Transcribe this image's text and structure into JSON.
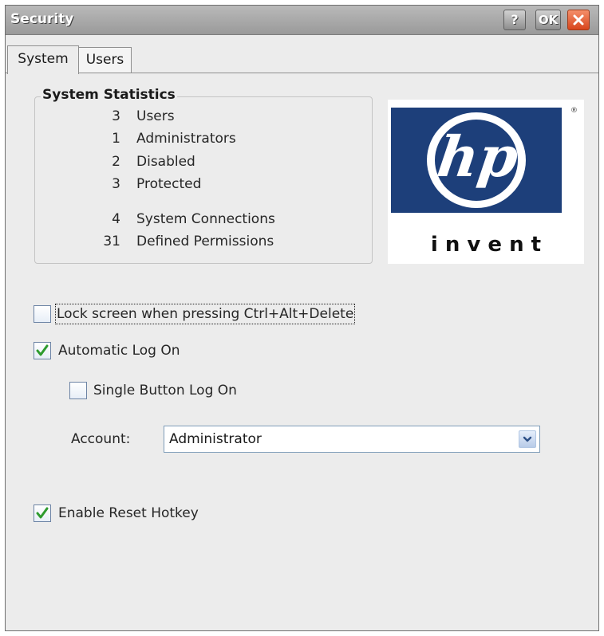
{
  "window": {
    "title": "Security",
    "help_button": "?",
    "ok_button": "OK",
    "close_button": "✕"
  },
  "tabs": [
    {
      "label": "System",
      "selected": true
    },
    {
      "label": "Users",
      "selected": false
    }
  ],
  "statistics": {
    "title": "System Statistics",
    "rows": [
      {
        "value": "3",
        "label": "Users"
      },
      {
        "value": "1",
        "label": "Administrators"
      },
      {
        "value": "2",
        "label": "Disabled"
      },
      {
        "value": "3",
        "label": "Protected"
      },
      {
        "value": "4",
        "label": "System Connections"
      },
      {
        "value": "31",
        "label": "Defined Permissions"
      }
    ]
  },
  "logo": {
    "mark": "hp",
    "tagline": "i n v e n t",
    "registered": "®",
    "brand_color": "#1d3f7a"
  },
  "options": {
    "lock_screen": {
      "label": "Lock screen when pressing Ctrl+Alt+Delete",
      "checked": false
    },
    "auto_logon": {
      "label": "Automatic Log On",
      "checked": true
    },
    "single_button": {
      "label": "Single Button Log On",
      "checked": false
    },
    "reset_hotkey": {
      "label": "Enable Reset Hotkey",
      "checked": true
    }
  },
  "account": {
    "label": "Account:",
    "value": "Administrator"
  },
  "colors": {
    "checkmark": "#2e9b2e",
    "close_button": "#e0522a"
  }
}
